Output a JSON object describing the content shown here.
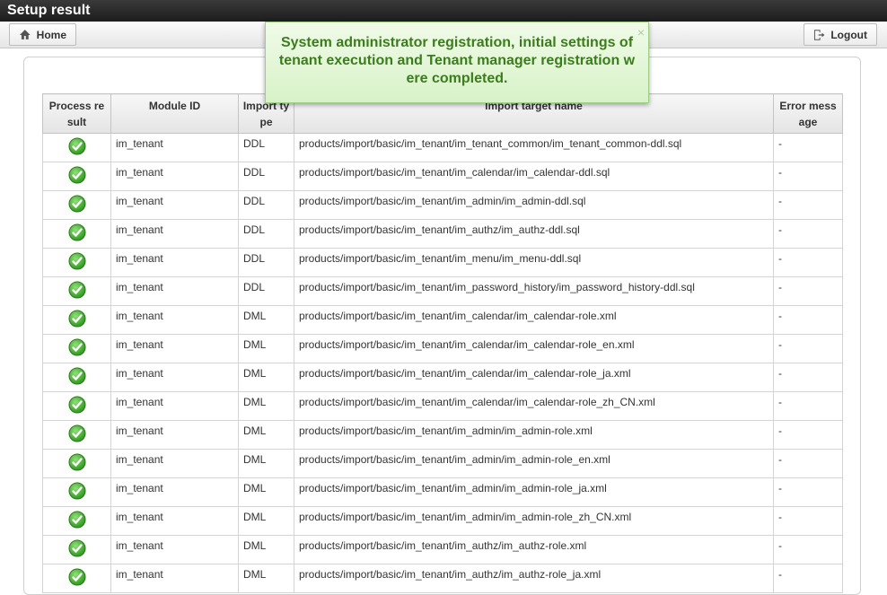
{
  "window": {
    "title": "Setup result"
  },
  "toolbar": {
    "home_label": "Home",
    "logout_label": "Logout"
  },
  "notice": {
    "message": "System administrator registration, initial settings of tenant execution and Tenant manager registration were completed.",
    "close": "×"
  },
  "table": {
    "headers": [
      "Process result",
      "Module ID",
      "Import type",
      "Import target name",
      "Error message"
    ],
    "rows": [
      {
        "module": "im_tenant",
        "type": "DDL",
        "target": "products/import/basic/im_tenant/im_tenant_common/im_tenant_common-ddl.sql",
        "error": "-"
      },
      {
        "module": "im_tenant",
        "type": "DDL",
        "target": "products/import/basic/im_tenant/im_calendar/im_calendar-ddl.sql",
        "error": "-"
      },
      {
        "module": "im_tenant",
        "type": "DDL",
        "target": "products/import/basic/im_tenant/im_admin/im_admin-ddl.sql",
        "error": "-"
      },
      {
        "module": "im_tenant",
        "type": "DDL",
        "target": "products/import/basic/im_tenant/im_authz/im_authz-ddl.sql",
        "error": "-"
      },
      {
        "module": "im_tenant",
        "type": "DDL",
        "target": "products/import/basic/im_tenant/im_menu/im_menu-ddl.sql",
        "error": "-"
      },
      {
        "module": "im_tenant",
        "type": "DDL",
        "target": "products/import/basic/im_tenant/im_password_history/im_password_history-ddl.sql",
        "error": "-"
      },
      {
        "module": "im_tenant",
        "type": "DML",
        "target": "products/import/basic/im_tenant/im_calendar/im_calendar-role.xml",
        "error": "-"
      },
      {
        "module": "im_tenant",
        "type": "DML",
        "target": "products/import/basic/im_tenant/im_calendar/im_calendar-role_en.xml",
        "error": "-"
      },
      {
        "module": "im_tenant",
        "type": "DML",
        "target": "products/import/basic/im_tenant/im_calendar/im_calendar-role_ja.xml",
        "error": "-"
      },
      {
        "module": "im_tenant",
        "type": "DML",
        "target": "products/import/basic/im_tenant/im_calendar/im_calendar-role_zh_CN.xml",
        "error": "-"
      },
      {
        "module": "im_tenant",
        "type": "DML",
        "target": "products/import/basic/im_tenant/im_admin/im_admin-role.xml",
        "error": "-"
      },
      {
        "module": "im_tenant",
        "type": "DML",
        "target": "products/import/basic/im_tenant/im_admin/im_admin-role_en.xml",
        "error": "-"
      },
      {
        "module": "im_tenant",
        "type": "DML",
        "target": "products/import/basic/im_tenant/im_admin/im_admin-role_ja.xml",
        "error": "-"
      },
      {
        "module": "im_tenant",
        "type": "DML",
        "target": "products/import/basic/im_tenant/im_admin/im_admin-role_zh_CN.xml",
        "error": "-"
      },
      {
        "module": "im_tenant",
        "type": "DML",
        "target": "products/import/basic/im_tenant/im_authz/im_authz-role.xml",
        "error": "-"
      },
      {
        "module": "im_tenant",
        "type": "DML",
        "target": "products/import/basic/im_tenant/im_authz/im_authz-role_ja.xml",
        "error": "-"
      }
    ]
  },
  "icons": {
    "status": "check-circle-icon",
    "home": "home-icon",
    "logout": "logout-icon"
  },
  "colors": {
    "success": "#3fae2a",
    "notice_text": "#3b7d1c"
  }
}
